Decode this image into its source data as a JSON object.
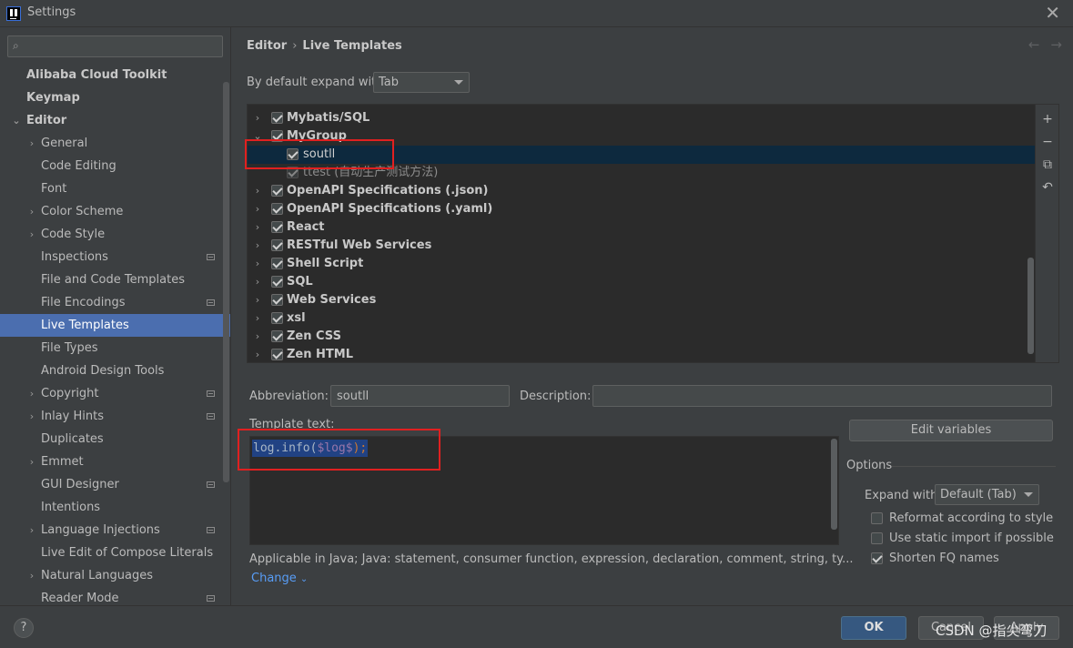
{
  "window": {
    "title": "Settings"
  },
  "sidebar": {
    "search_placeholder": "",
    "items": [
      {
        "label": "Alibaba Cloud Toolkit"
      },
      {
        "label": "Keymap"
      },
      {
        "label": "Editor"
      },
      {
        "label": "General"
      },
      {
        "label": "Code Editing"
      },
      {
        "label": "Font"
      },
      {
        "label": "Color Scheme"
      },
      {
        "label": "Code Style"
      },
      {
        "label": "Inspections"
      },
      {
        "label": "File and Code Templates"
      },
      {
        "label": "File Encodings"
      },
      {
        "label": "Live Templates"
      },
      {
        "label": "File Types"
      },
      {
        "label": "Android Design Tools"
      },
      {
        "label": "Copyright"
      },
      {
        "label": "Inlay Hints"
      },
      {
        "label": "Duplicates"
      },
      {
        "label": "Emmet"
      },
      {
        "label": "GUI Designer"
      },
      {
        "label": "Intentions"
      },
      {
        "label": "Language Injections"
      },
      {
        "label": "Live Edit of Compose Literals"
      },
      {
        "label": "Natural Languages"
      },
      {
        "label": "Reader Mode"
      }
    ]
  },
  "breadcrumb": {
    "parent": "Editor",
    "current": "Live Templates"
  },
  "expand": {
    "label": "By default expand with",
    "value": "Tab"
  },
  "templates": [
    {
      "label": "Mybatis/SQL"
    },
    {
      "label": "MyGroup"
    },
    {
      "label": "soutll"
    },
    {
      "label": "ttest",
      "note": "(自动生产测试方法)"
    },
    {
      "label": "OpenAPI Specifications (.json)"
    },
    {
      "label": "OpenAPI Specifications (.yaml)"
    },
    {
      "label": "React"
    },
    {
      "label": "RESTful Web Services"
    },
    {
      "label": "Shell Script"
    },
    {
      "label": "SQL"
    },
    {
      "label": "Web Services"
    },
    {
      "label": "xsl"
    },
    {
      "label": "Zen CSS"
    },
    {
      "label": "Zen HTML"
    }
  ],
  "toolbar": {
    "add": "+",
    "remove": "−",
    "copy": "⧉",
    "restore": "↶"
  },
  "details": {
    "abbreviation_label": "Abbreviation:",
    "abbreviation_value": "soutll",
    "description_label": "Description:",
    "description_value": "",
    "template_text_label": "Template text:",
    "code": {
      "prefix": "log.info(",
      "var": "$log$",
      "suffix": ");"
    },
    "edit_variables": "Edit variables",
    "options_title": "Options",
    "expand_with_label": "Expand with",
    "expand_with_value": "Default (Tab)",
    "reformat": "Reformat according to style",
    "static_import": "Use static import if possible",
    "shorten_fq": "Shorten FQ names",
    "applicable": "Applicable in Java; Java: statement, consumer function, expression, declaration, comment, string, ty...",
    "change": "Change"
  },
  "footer": {
    "help": "?",
    "ok": "OK",
    "cancel": "Cancel",
    "apply": "Apply",
    "watermark": "CSDN @指尖弯刀"
  }
}
